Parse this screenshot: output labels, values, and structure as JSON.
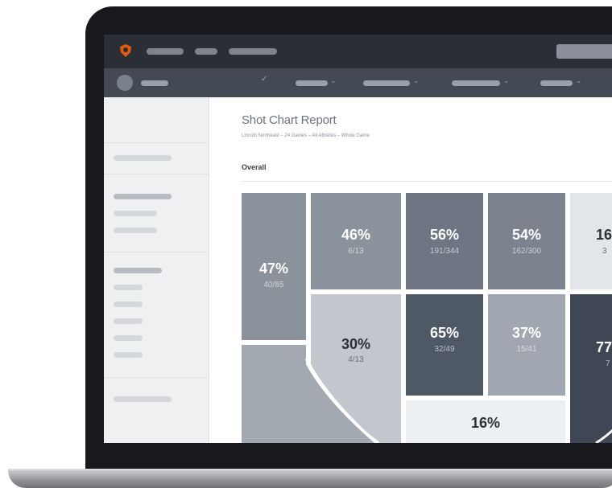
{
  "report": {
    "title": "Shot Chart Report",
    "subtitle": "Lincoln Northeast  –  24 Games  –  All Athletes  –  Whole Game",
    "section": "Overall"
  },
  "colors": {
    "top_nav": "#2a2f36",
    "sub_nav": "#434a53",
    "logo_accent": "#e8590c",
    "zone_light": "#c2c7cd",
    "zone_mid": "#8a929c",
    "zone_dark": "#5b6470",
    "zone_darkest": "#3e4753"
  },
  "chart_data": {
    "type": "heatmap",
    "zones": [
      {
        "pct": "47%",
        "made_attempted": "40/85"
      },
      {
        "pct": "46%",
        "made_attempted": "6/13"
      },
      {
        "pct": "56%",
        "made_attempted": "191/344"
      },
      {
        "pct": "54%",
        "made_attempted": "162/300"
      },
      {
        "pct": "16",
        "made_attempted": "3"
      },
      {
        "pct": "30%",
        "made_attempted": "4/13"
      },
      {
        "pct": "65%",
        "made_attempted": "32/49"
      },
      {
        "pct": "37%",
        "made_attempted": "15/41"
      },
      {
        "pct": "77",
        "made_attempted": "7"
      },
      {
        "pct": "16%",
        "made_attempted": ""
      }
    ]
  }
}
